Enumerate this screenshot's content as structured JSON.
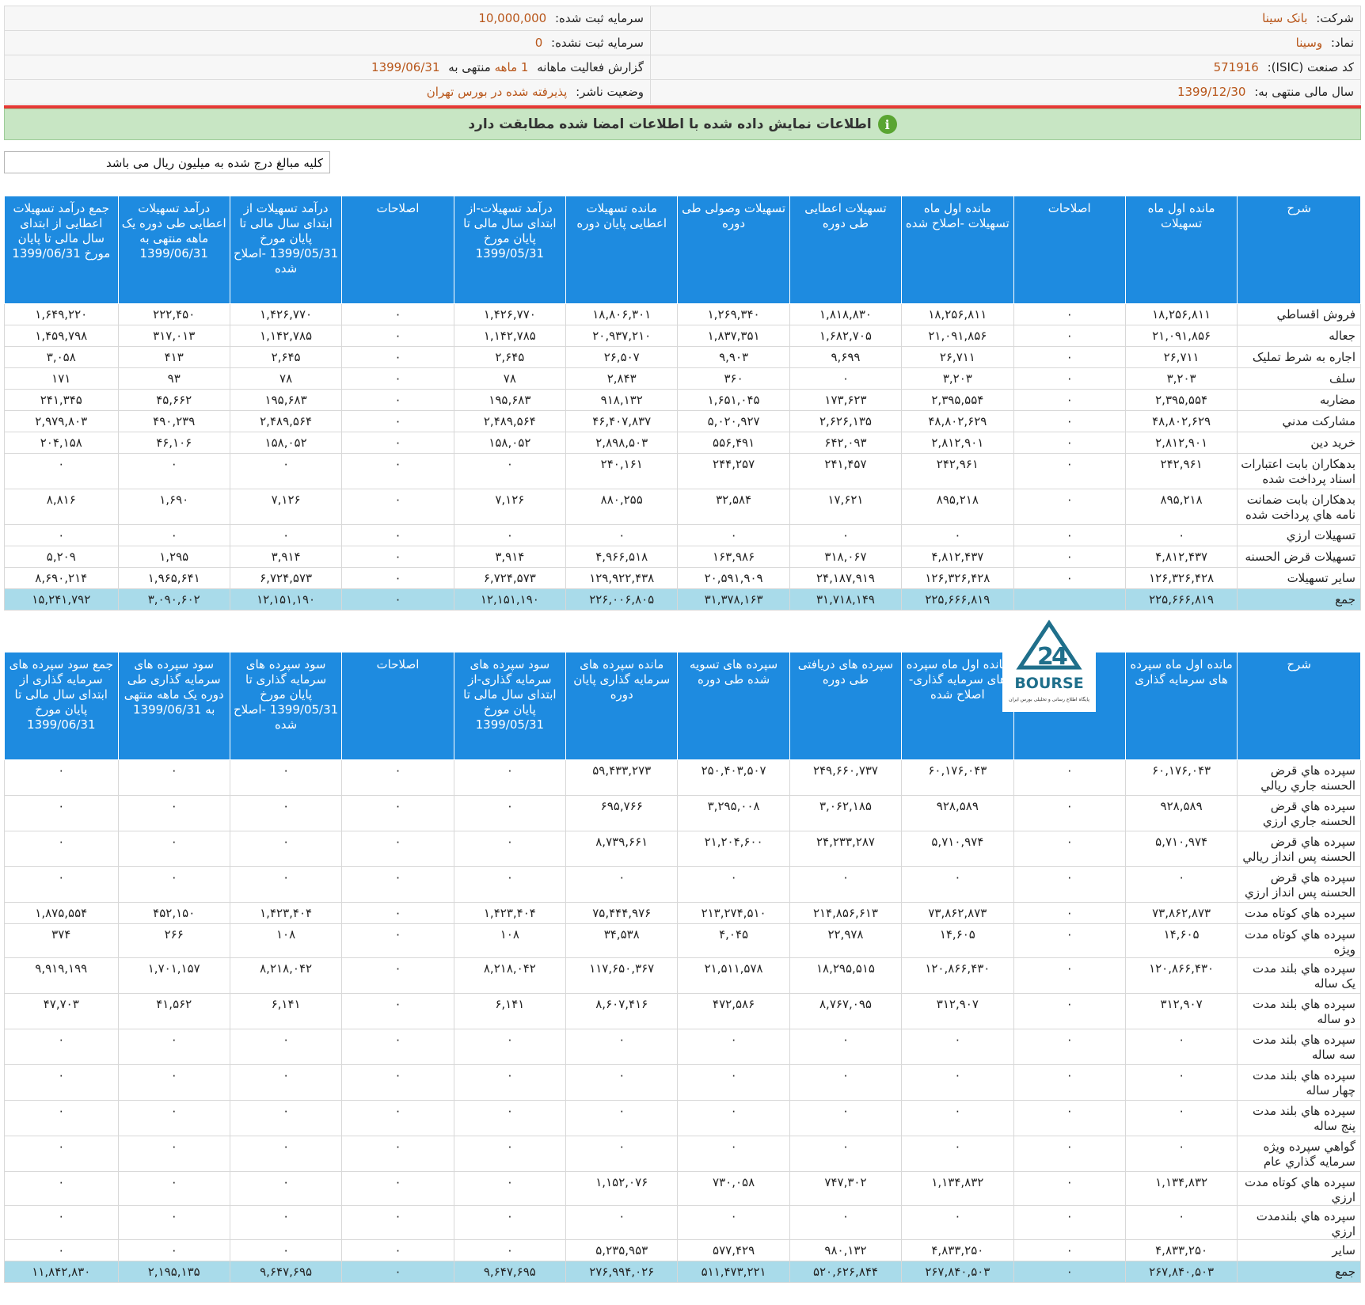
{
  "header": {
    "company_label": "شرکت:",
    "company": "بانک سینا",
    "symbol_label": "نماد:",
    "symbol": "وسینا",
    "isic_label": "کد صنعت (ISIC):",
    "isic": "571916",
    "fiscal_label": "سال مالی منتهی به:",
    "fiscal": "1399/12/30",
    "capital_label": "سرمایه ثبت شده:",
    "capital": "10,000,000",
    "unreg_label": "سرمایه ثبت نشده:",
    "unreg": "0",
    "report_prefix": "گزارش فعالیت ماهانه",
    "report_period": "1 ماهه",
    "report_mid": "منتهی به",
    "report_date": "1399/06/31",
    "status_label": "وضعیت ناشر:",
    "status": "پذیرفته شده در بورس تهران"
  },
  "banner": {
    "icon": "i",
    "text": "اطلاعات نمایش داده شده با اطلاعات امضا شده مطابقت دارد"
  },
  "unit_note": "کلیه مبالغ درج شده به میلیون ریال می باشد",
  "logo": {
    "text": "BOURSE",
    "subtitle": "پایگاه اطلاع رسانی و تحلیلی بورس ایران"
  },
  "table1": {
    "headers": [
      "شرح",
      "مانده اول ماه تسهیلات",
      "اصلاحات",
      "مانده اول ماه تسهیلات -اصلاح شده",
      "تسهیلات اعطایی طی دوره",
      "تسهیلات وصولی طی دوره",
      "مانده تسهیلات اعطایی پایان دوره",
      "درآمد تسهیلات-از ابتدای سال مالی تا پایان مورخ 1399/05/31",
      "اصلاحات",
      "درآمد تسهیلات از ابتدای سال مالی تا پایان مورخ 1399/05/31 -اصلاح شده",
      "درآمد تسهیلات اعطایی طی دوره یک ماهه منتهی به 1399/06/31",
      "جمع درآمد تسهیلات اعطایی از ابتدای سال مالی تا پایان مورخ 1399/06/31"
    ],
    "rows": [
      [
        "فروش اقساطي",
        "۱۸,۲۵۶,۸۱۱",
        "۰",
        "۱۸,۲۵۶,۸۱۱",
        "۱,۸۱۸,۸۳۰",
        "۱,۲۶۹,۳۴۰",
        "۱۸,۸۰۶,۳۰۱",
        "۱,۴۲۶,۷۷۰",
        "۰",
        "۱,۴۲۶,۷۷۰",
        "۲۲۲,۴۵۰",
        "۱,۶۴۹,۲۲۰"
      ],
      [
        "جعاله",
        "۲۱,۰۹۱,۸۵۶",
        "۰",
        "۲۱,۰۹۱,۸۵۶",
        "۱,۶۸۲,۷۰۵",
        "۱,۸۳۷,۳۵۱",
        "۲۰,۹۳۷,۲۱۰",
        "۱,۱۴۲,۷۸۵",
        "۰",
        "۱,۱۴۲,۷۸۵",
        "۳۱۷,۰۱۳",
        "۱,۴۵۹,۷۹۸"
      ],
      [
        "اجاره به شرط تمليک",
        "۲۶,۷۱۱",
        "۰",
        "۲۶,۷۱۱",
        "۹,۶۹۹",
        "۹,۹۰۳",
        "۲۶,۵۰۷",
        "۲,۶۴۵",
        "۰",
        "۲,۶۴۵",
        "۴۱۳",
        "۳,۰۵۸"
      ],
      [
        "سلف",
        "۳,۲۰۳",
        "۰",
        "۳,۲۰۳",
        "۰",
        "۳۶۰",
        "۲,۸۴۳",
        "۷۸",
        "۰",
        "۷۸",
        "۹۳",
        "۱۷۱"
      ],
      [
        "مضاربه",
        "۲,۳۹۵,۵۵۴",
        "۰",
        "۲,۳۹۵,۵۵۴",
        "۱۷۳,۶۲۳",
        "۱,۶۵۱,۰۴۵",
        "۹۱۸,۱۳۲",
        "۱۹۵,۶۸۳",
        "۰",
        "۱۹۵,۶۸۳",
        "۴۵,۶۶۲",
        "۲۴۱,۳۴۵"
      ],
      [
        "مشارکت مدني",
        "۴۸,۸۰۲,۶۲۹",
        "۰",
        "۴۸,۸۰۲,۶۲۹",
        "۲,۶۲۶,۱۳۵",
        "۵,۰۲۰,۹۲۷",
        "۴۶,۴۰۷,۸۳۷",
        "۲,۴۸۹,۵۶۴",
        "۰",
        "۲,۴۸۹,۵۶۴",
        "۴۹۰,۲۳۹",
        "۲,۹۷۹,۸۰۳"
      ],
      [
        "خريد دين",
        "۲,۸۱۲,۹۰۱",
        "۰",
        "۲,۸۱۲,۹۰۱",
        "۶۴۲,۰۹۳",
        "۵۵۶,۴۹۱",
        "۲,۸۹۸,۵۰۳",
        "۱۵۸,۰۵۲",
        "۰",
        "۱۵۸,۰۵۲",
        "۴۶,۱۰۶",
        "۲۰۴,۱۵۸"
      ],
      [
        "بدهكاران بابت اعتبارات اسناد پرداخت شده",
        "۲۴۲,۹۶۱",
        "۰",
        "۲۴۲,۹۶۱",
        "۲۴۱,۴۵۷",
        "۲۴۴,۲۵۷",
        "۲۴۰,۱۶۱",
        "۰",
        "۰",
        "۰",
        "۰",
        "۰"
      ],
      [
        "بدهكاران بابت ضمانت نامه هاي پرداخت شده",
        "۸۹۵,۲۱۸",
        "۰",
        "۸۹۵,۲۱۸",
        "۱۷,۶۲۱",
        "۳۲,۵۸۴",
        "۸۸۰,۲۵۵",
        "۷,۱۲۶",
        "۰",
        "۷,۱۲۶",
        "۱,۶۹۰",
        "۸,۸۱۶"
      ],
      [
        "تسهيلات ارزي",
        "۰",
        "۰",
        "۰",
        "۰",
        "۰",
        "۰",
        "۰",
        "۰",
        "۰",
        "۰",
        "۰"
      ],
      [
        "تسهيلات قرض الحسنه",
        "۴,۸۱۲,۴۳۷",
        "۰",
        "۴,۸۱۲,۴۳۷",
        "۳۱۸,۰۶۷",
        "۱۶۳,۹۸۶",
        "۴,۹۶۶,۵۱۸",
        "۳,۹۱۴",
        "۰",
        "۳,۹۱۴",
        "۱,۲۹۵",
        "۵,۲۰۹"
      ],
      [
        "ساير تسهيلات",
        "۱۲۶,۳۲۶,۴۲۸",
        "۰",
        "۱۲۶,۳۲۶,۴۲۸",
        "۲۴,۱۸۷,۹۱۹",
        "۲۰,۵۹۱,۹۰۹",
        "۱۲۹,۹۲۲,۴۳۸",
        "۶,۷۲۴,۵۷۳",
        "۰",
        "۶,۷۲۴,۵۷۳",
        "۱,۹۶۵,۶۴۱",
        "۸,۶۹۰,۲۱۴"
      ]
    ],
    "total": [
      "جمع",
      "۲۲۵,۶۶۶,۸۱۹",
      "",
      "۲۲۵,۶۶۶,۸۱۹",
      "۳۱,۷۱۸,۱۴۹",
      "۳۱,۳۷۸,۱۶۳",
      "۲۲۶,۰۰۶,۸۰۵",
      "۱۲,۱۵۱,۱۹۰",
      "۰",
      "۱۲,۱۵۱,۱۹۰",
      "۳,۰۹۰,۶۰۲",
      "۱۵,۲۴۱,۷۹۲"
    ]
  },
  "table2": {
    "headers": [
      "شرح",
      "مانده اول ماه سپرده های سرمایه گذاری",
      "",
      "مانده اول ماه سپرده های سرمایه گذاری- اصلاح شده",
      "سپرده های دریافتی طی دوره",
      "سپرده های تسویه شده طی دوره",
      "مانده سپرده های سرمایه گذاری پایان دوره",
      "سود سپرده های سرمایه گذاری-از ابتدای سال مالی تا پایان مورخ 1399/05/31",
      "اصلاحات",
      "سود سپرده های سرمایه گذاری تا پایان مورخ 1399/05/31 -اصلاح شده",
      "سود سپرده های سرمایه گذاری طی دوره یک ماهه منتهی به 1399/06/31",
      "جمع سود سپرده های سرمایه گذاری از ابتدای سال مالی تا پایان مورخ 1399/06/31"
    ],
    "rows": [
      [
        "سپرده هاي قرض الحسنه جاري ريالي",
        "۶۰,۱۷۶,۰۴۳",
        "۰",
        "۶۰,۱۷۶,۰۴۳",
        "۲۴۹,۶۶۰,۷۳۷",
        "۲۵۰,۴۰۳,۵۰۷",
        "۵۹,۴۳۳,۲۷۳",
        "۰",
        "۰",
        "۰",
        "۰",
        "۰"
      ],
      [
        "سپرده هاي قرض الحسنه جاري ارزي",
        "۹۲۸,۵۸۹",
        "۰",
        "۹۲۸,۵۸۹",
        "۳,۰۶۲,۱۸۵",
        "۳,۲۹۵,۰۰۸",
        "۶۹۵,۷۶۶",
        "۰",
        "۰",
        "۰",
        "۰",
        "۰"
      ],
      [
        "سپرده هاي قرض الحسنه پس انداز ريالي",
        "۵,۷۱۰,۹۷۴",
        "۰",
        "۵,۷۱۰,۹۷۴",
        "۲۴,۲۳۳,۲۸۷",
        "۲۱,۲۰۴,۶۰۰",
        "۸,۷۳۹,۶۶۱",
        "۰",
        "۰",
        "۰",
        "۰",
        "۰"
      ],
      [
        "سپرده هاي قرض الحسنه پس انداز ارزي",
        "۰",
        "۰",
        "۰",
        "۰",
        "۰",
        "۰",
        "۰",
        "۰",
        "۰",
        "۰",
        "۰"
      ],
      [
        "سپرده هاي كوتاه مدت",
        "۷۳,۸۶۲,۸۷۳",
        "۰",
        "۷۳,۸۶۲,۸۷۳",
        "۲۱۴,۸۵۶,۶۱۳",
        "۲۱۳,۲۷۴,۵۱۰",
        "۷۵,۴۴۴,۹۷۶",
        "۱,۴۲۳,۴۰۴",
        "۰",
        "۱,۴۲۳,۴۰۴",
        "۴۵۲,۱۵۰",
        "۱,۸۷۵,۵۵۴"
      ],
      [
        "سپرده هاي كوتاه مدت ويژه",
        "۱۴,۶۰۵",
        "۰",
        "۱۴,۶۰۵",
        "۲۲,۹۷۸",
        "۴,۰۴۵",
        "۳۴,۵۳۸",
        "۱۰۸",
        "۰",
        "۱۰۸",
        "۲۶۶",
        "۳۷۴"
      ],
      [
        "سپرده هاي بلند مدت يک ساله",
        "۱۲۰,۸۶۶,۴۳۰",
        "۰",
        "۱۲۰,۸۶۶,۴۳۰",
        "۱۸,۲۹۵,۵۱۵",
        "۲۱,۵۱۱,۵۷۸",
        "۱۱۷,۶۵۰,۳۶۷",
        "۸,۲۱۸,۰۴۲",
        "۰",
        "۸,۲۱۸,۰۴۲",
        "۱,۷۰۱,۱۵۷",
        "۹,۹۱۹,۱۹۹"
      ],
      [
        "سپرده هاي بلند مدت دو ساله",
        "۳۱۲,۹۰۷",
        "۰",
        "۳۱۲,۹۰۷",
        "۸,۷۶۷,۰۹۵",
        "۴۷۲,۵۸۶",
        "۸,۶۰۷,۴۱۶",
        "۶,۱۴۱",
        "۰",
        "۶,۱۴۱",
        "۴۱,۵۶۲",
        "۴۷,۷۰۳"
      ],
      [
        "سپرده هاي بلند مدت سه ساله",
        "۰",
        "۰",
        "۰",
        "۰",
        "۰",
        "۰",
        "۰",
        "۰",
        "۰",
        "۰",
        "۰"
      ],
      [
        "سپرده هاي بلند مدت چهار ساله",
        "۰",
        "۰",
        "۰",
        "۰",
        "۰",
        "۰",
        "۰",
        "۰",
        "۰",
        "۰",
        "۰"
      ],
      [
        "سپرده هاي بلند مدت پنج ساله",
        "۰",
        "۰",
        "۰",
        "۰",
        "۰",
        "۰",
        "۰",
        "۰",
        "۰",
        "۰",
        "۰"
      ],
      [
        "گواهي سپرده ويژه سرمايه گذاري عام",
        "۰",
        "۰",
        "۰",
        "۰",
        "۰",
        "۰",
        "۰",
        "۰",
        "۰",
        "۰",
        "۰"
      ],
      [
        "سپرده هاي كوتاه مدت ارزي",
        "۱,۱۳۴,۸۳۲",
        "۰",
        "۱,۱۳۴,۸۳۲",
        "۷۴۷,۳۰۲",
        "۷۳۰,۰۵۸",
        "۱,۱۵۲,۰۷۶",
        "۰",
        "۰",
        "۰",
        "۰",
        "۰"
      ],
      [
        "سپرده هاي بلندمدت ارزي",
        "۰",
        "۰",
        "۰",
        "۰",
        "۰",
        "۰",
        "۰",
        "۰",
        "۰",
        "۰",
        "۰"
      ],
      [
        "ساير",
        "۴,۸۳۳,۲۵۰",
        "۰",
        "۴,۸۳۳,۲۵۰",
        "۹۸۰,۱۳۲",
        "۵۷۷,۴۲۹",
        "۵,۲۳۵,۹۵۳",
        "۰",
        "۰",
        "۰",
        "۰",
        "۰"
      ]
    ],
    "total": [
      "جمع",
      "۲۶۷,۸۴۰,۵۰۳",
      "۰",
      "۲۶۷,۸۴۰,۵۰۳",
      "۵۲۰,۶۲۶,۸۴۴",
      "۵۱۱,۴۷۳,۲۲۱",
      "۲۷۶,۹۹۴,۰۲۶",
      "۹,۶۴۷,۶۹۵",
      "۰",
      "۹,۶۴۷,۶۹۵",
      "۲,۱۹۵,۱۳۵",
      "۱۱,۸۴۲,۸۳۰"
    ]
  }
}
